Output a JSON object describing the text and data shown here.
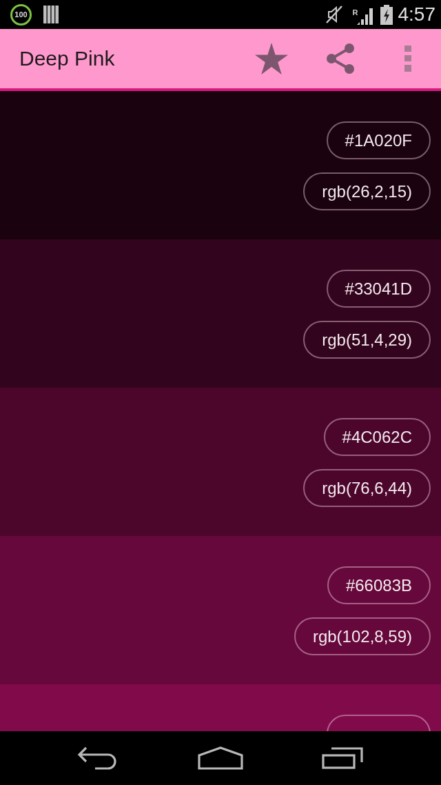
{
  "status_bar": {
    "battery_badge": "100",
    "network_letter": "R",
    "time": "4:57"
  },
  "app_bar": {
    "title": "Deep Pink"
  },
  "swatches": [
    {
      "color": "#1a020f",
      "hex": "#1A020F",
      "rgb": "rgb(26,2,15)"
    },
    {
      "color": "#33041d",
      "hex": "#33041D",
      "rgb": "rgb(51,4,29)"
    },
    {
      "color": "#4c062c",
      "hex": "#4C062C",
      "rgb": "rgb(76,6,44)"
    },
    {
      "color": "#66083b",
      "hex": "#66083B",
      "rgb": "rgb(102,8,59)"
    },
    {
      "color": "#800a4a"
    }
  ]
}
